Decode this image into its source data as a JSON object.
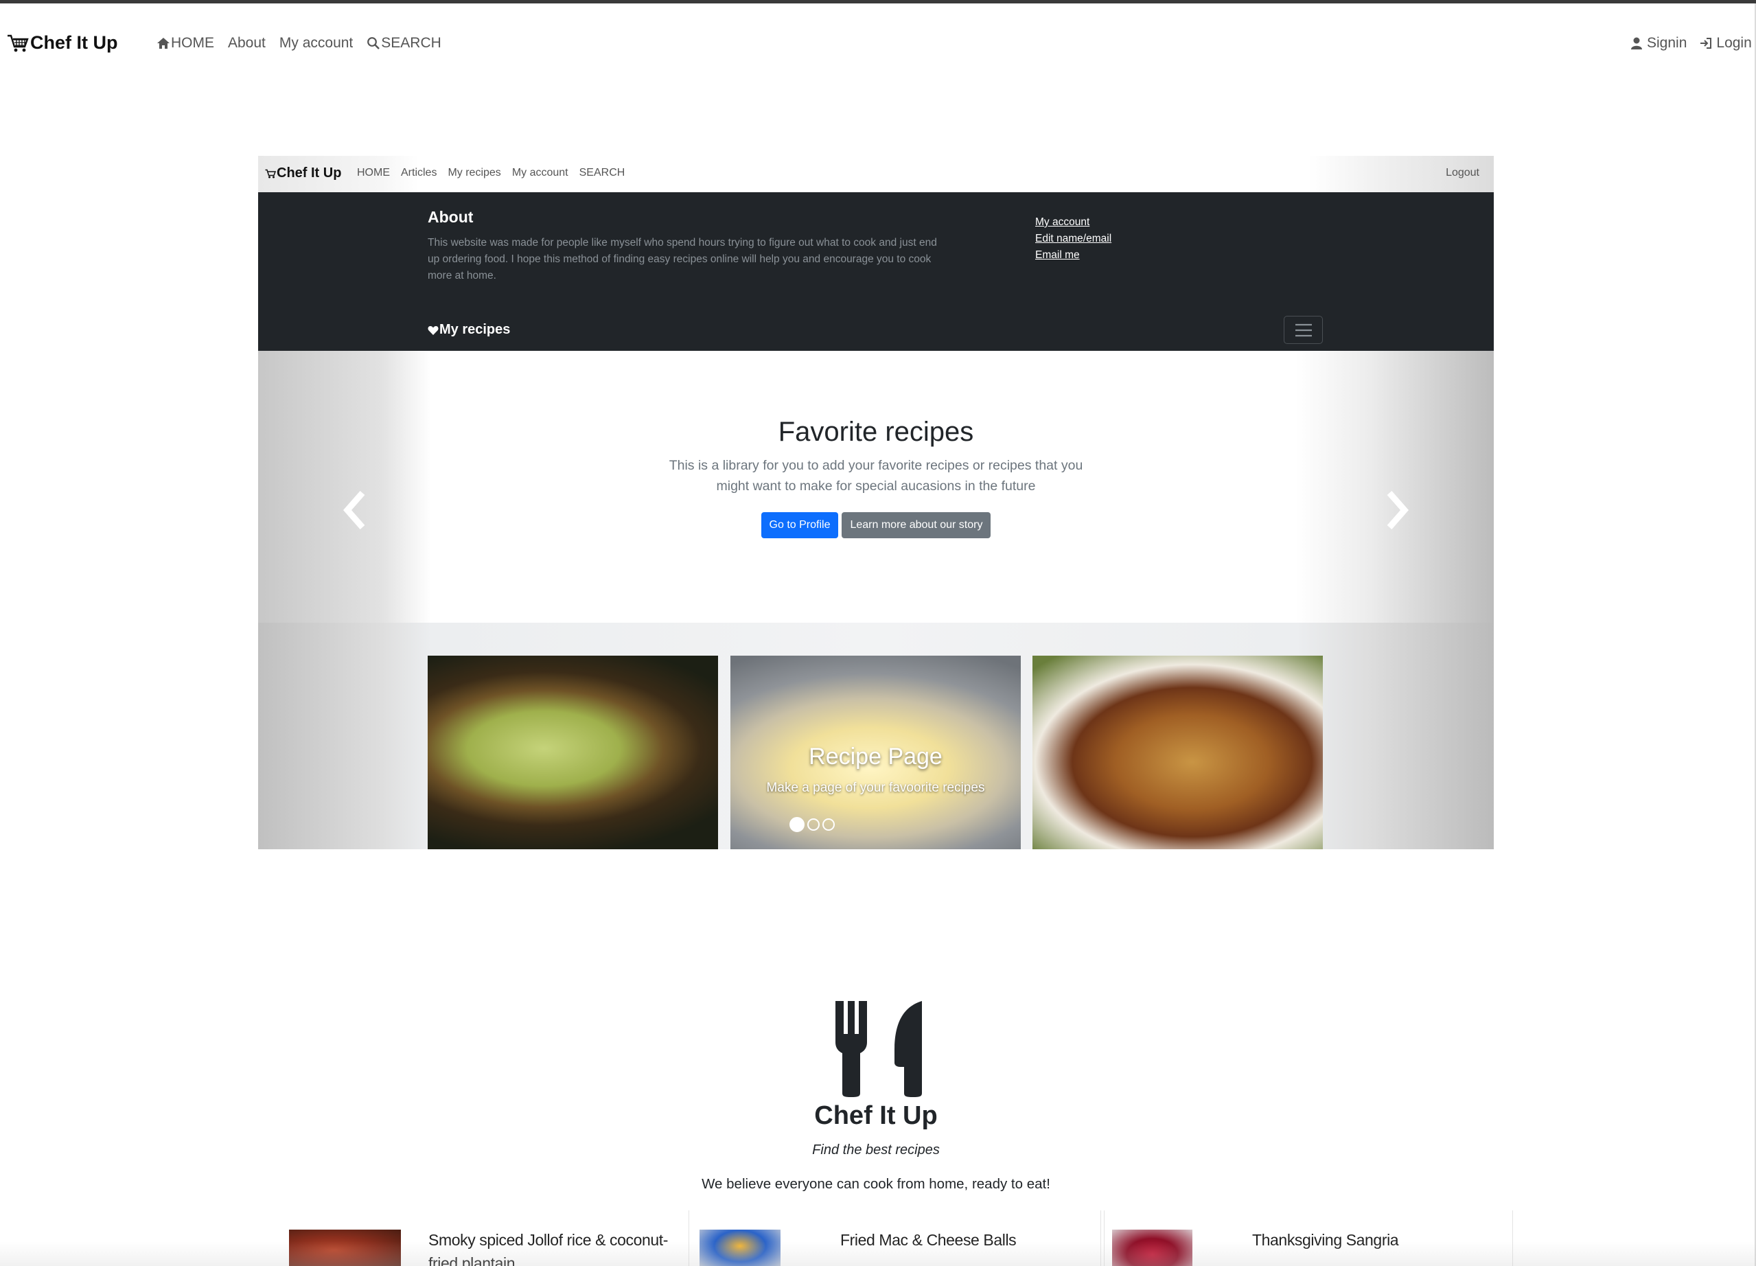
{
  "outer_nav": {
    "brand": "Chef It Up",
    "links": [
      "HOME",
      "About",
      "My account",
      "SEARCH"
    ],
    "signin": "Signin",
    "login": "Login"
  },
  "inner_nav": {
    "brand": "Chef It Up",
    "links": [
      "HOME",
      "Articles",
      "My recipes",
      "My account",
      "SEARCH"
    ],
    "logout": "Logout"
  },
  "about": {
    "title": "About",
    "text": "This website was made for people like myself who spend hours trying to figure out what to cook and just end up ordering food. I hope this method of finding easy recipes online will help you and encourage you to cook more at home.",
    "links": [
      "My account",
      "Edit name/email",
      "Email me"
    ],
    "my_recipes": "My recipes"
  },
  "hero": {
    "title": "Favorite recipes",
    "text": "This is a library for you to add your favorite recipes or recipes that you might want to make for special aucasions in the future",
    "primary_button": "Go to Profile",
    "secondary_button": "Learn more about our story"
  },
  "carousel": {
    "caption_title": "Recipe Page",
    "caption_text": "Make a page of your favoorite recipes",
    "slide_count": 3,
    "active_slide": 1
  },
  "site": {
    "title": "Chef It Up",
    "subtitle": "Find the best recipes",
    "description": "We believe everyone can cook from home, ready to eat!"
  },
  "recipes": [
    {
      "title": "Smoky spiced Jollof rice & coconut-fried plantain"
    },
    {
      "title": "Fried Mac & Cheese Balls"
    },
    {
      "title": "Thanksgiving Sangria"
    }
  ],
  "colors": {
    "primary": "#0d6efd",
    "secondary": "#6c757d",
    "dark": "#212529"
  }
}
